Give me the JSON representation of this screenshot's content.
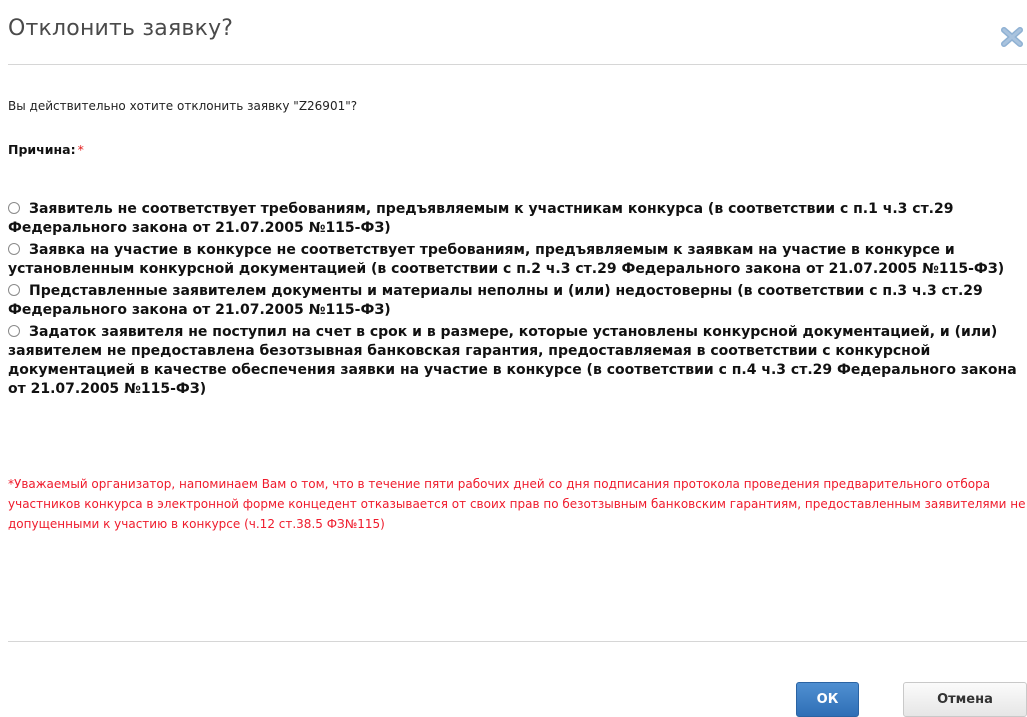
{
  "dialog": {
    "title": "Отклонить заявку?",
    "close_icon": "close-x-icon",
    "question": "Вы действительно хотите отклонить заявку \"Z26901\"?",
    "reason_label": "Причина:",
    "required_marker": "*",
    "options": [
      {
        "label": "Заявитель не соответствует требованиям, предъявляемым к участникам конкурса (в соответствии с п.1 ч.3 ст.29 Федерального закона от 21.07.2005 №115-ФЗ)",
        "selected": false
      },
      {
        "label": "Заявка на участие в конкурсе не соответствует требованиям, предъявляемым к заявкам на участие в конкурсе и установленным конкурсной документацией (в соответствии с п.2 ч.3 ст.29 Федерального закона от 21.07.2005 №115-ФЗ)",
        "selected": false
      },
      {
        "label": "Представленные заявителем документы и материалы неполны и (или) недостоверны (в соответствии с п.3 ч.3 ст.29 Федерального закона от 21.07.2005 №115-ФЗ)",
        "selected": false
      },
      {
        "label": "Задаток заявителя не поступил на счет в срок и в размере, которые установлены конкурсной документацией, и (или) заявителем не предоставлена безотзывная банковская гарантия, предоставляемая в соответствии с конкурсной документацией в качестве обеспечения заявки на участие в конкурсе (в соответствии с п.4 ч.3 ст.29 Федерального закона от 21.07.2005 №115-ФЗ)",
        "selected": false
      }
    ],
    "notice": "*Уважаемый организатор, напоминаем Вам о том, что в течение пяти рабочих дней со дня подписания протокола проведения предварительного отбора участников конкурса в электронной форме концедент отказывается от своих прав по безотзывным банковским гарантиям, предоставленным заявителями не допущенными к участию в конкурсе (ч.12 ст.38.5 ФЗ№115)",
    "ok_label": "ОК",
    "cancel_label": "Отмена"
  },
  "colors": {
    "close_icon": "#8fb1d3",
    "required": "#e21b1b",
    "notice": "#ef1b2c",
    "ok_button": "#3a7cc0"
  }
}
